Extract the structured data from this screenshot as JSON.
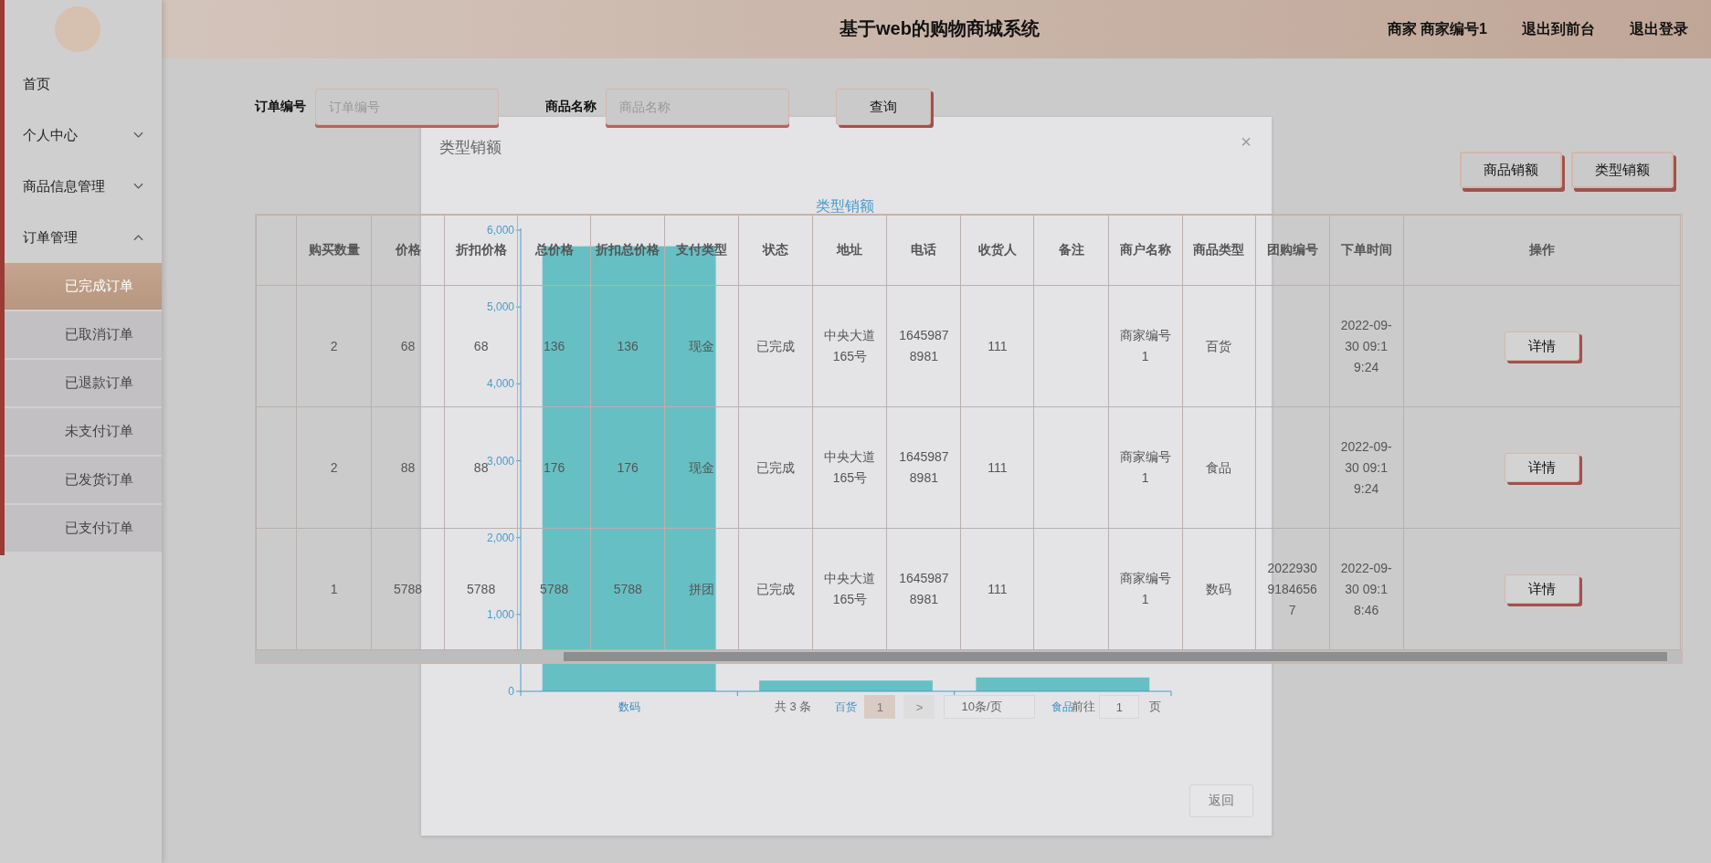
{
  "header": {
    "title": "基于web的购物商城系统",
    "user_label": "商家 商家编号1",
    "links": [
      "退出到前台",
      "退出登录"
    ]
  },
  "sidebar": {
    "items": [
      {
        "label": "首页",
        "kind": "link"
      },
      {
        "label": "个人中心",
        "kind": "menu",
        "expanded": false
      },
      {
        "label": "商品信息管理",
        "kind": "menu",
        "expanded": false
      },
      {
        "label": "订单管理",
        "kind": "menu",
        "expanded": true,
        "children": [
          {
            "label": "已完成订单",
            "selected": true
          },
          {
            "label": "已取消订单",
            "selected": false
          },
          {
            "label": "已退款订单",
            "selected": false
          },
          {
            "label": "未支付订单",
            "selected": false
          },
          {
            "label": "已发货订单",
            "selected": false
          },
          {
            "label": "已支付订单",
            "selected": false
          }
        ]
      }
    ]
  },
  "search": {
    "fields": [
      {
        "label": "订单编号",
        "placeholder": "订单编号"
      },
      {
        "label": "商品名称",
        "placeholder": "商品名称"
      }
    ],
    "button": "查询"
  },
  "actions": [
    "商品销额",
    "类型销额"
  ],
  "table": {
    "columns": [
      "购买数量",
      "价格",
      "折扣价格",
      "总价格",
      "折扣总价格",
      "支付类型",
      "状态",
      "地址",
      "电话",
      "收货人",
      "备注",
      "商户名称",
      "商品类型",
      "团购编号",
      "下单时间",
      "操作"
    ],
    "rows": [
      {
        "cells": [
          "2",
          "68",
          "68",
          "136",
          "136",
          "现金",
          "已完成",
          "中央大道165号",
          "16459878981",
          "111",
          null,
          "商家编号1",
          "百货",
          null,
          "2022-09-30 09:19:24"
        ],
        "action": "详情"
      },
      {
        "cells": [
          "2",
          "88",
          "88",
          "176",
          "176",
          "现金",
          "已完成",
          "中央大道165号",
          "16459878981",
          "111",
          null,
          "商家编号1",
          "食品",
          null,
          "2022-09-30 09:19:24"
        ],
        "action": "详情"
      },
      {
        "cells": [
          "1",
          "5788",
          "5788",
          "5788",
          "5788",
          "拼团",
          "已完成",
          "中央大道165号",
          "16459878981",
          "111",
          null,
          "商家编号1",
          "数码",
          "202293091846567",
          "2022-09-30 09:18:46"
        ],
        "action": "详情"
      }
    ]
  },
  "pagination": {
    "total": "共 3 条",
    "page": "1",
    "next": ">",
    "page_size": "10条/页",
    "goto_label": "前往",
    "goto_value": "1",
    "page_suffix": "页"
  },
  "dialog": {
    "title": "类型销额",
    "close": "×",
    "back_button": "返回",
    "chart_data": {
      "type": "bar",
      "title": "类型销额",
      "categories": [
        "数码",
        "百货",
        "食品"
      ],
      "values": [
        5790,
        140,
        180
      ],
      "ylim": [
        0,
        6000
      ],
      "yticks": [
        {
          "value": 0,
          "label": "0"
        },
        {
          "value": 1000,
          "label": "1,000"
        },
        {
          "value": 2000,
          "label": "2,000"
        },
        {
          "value": 3000,
          "label": "3,000"
        },
        {
          "value": 4000,
          "label": "4,000"
        },
        {
          "value": 5000,
          "label": "5,000"
        },
        {
          "value": 6000,
          "label": "6,000"
        }
      ]
    }
  }
}
